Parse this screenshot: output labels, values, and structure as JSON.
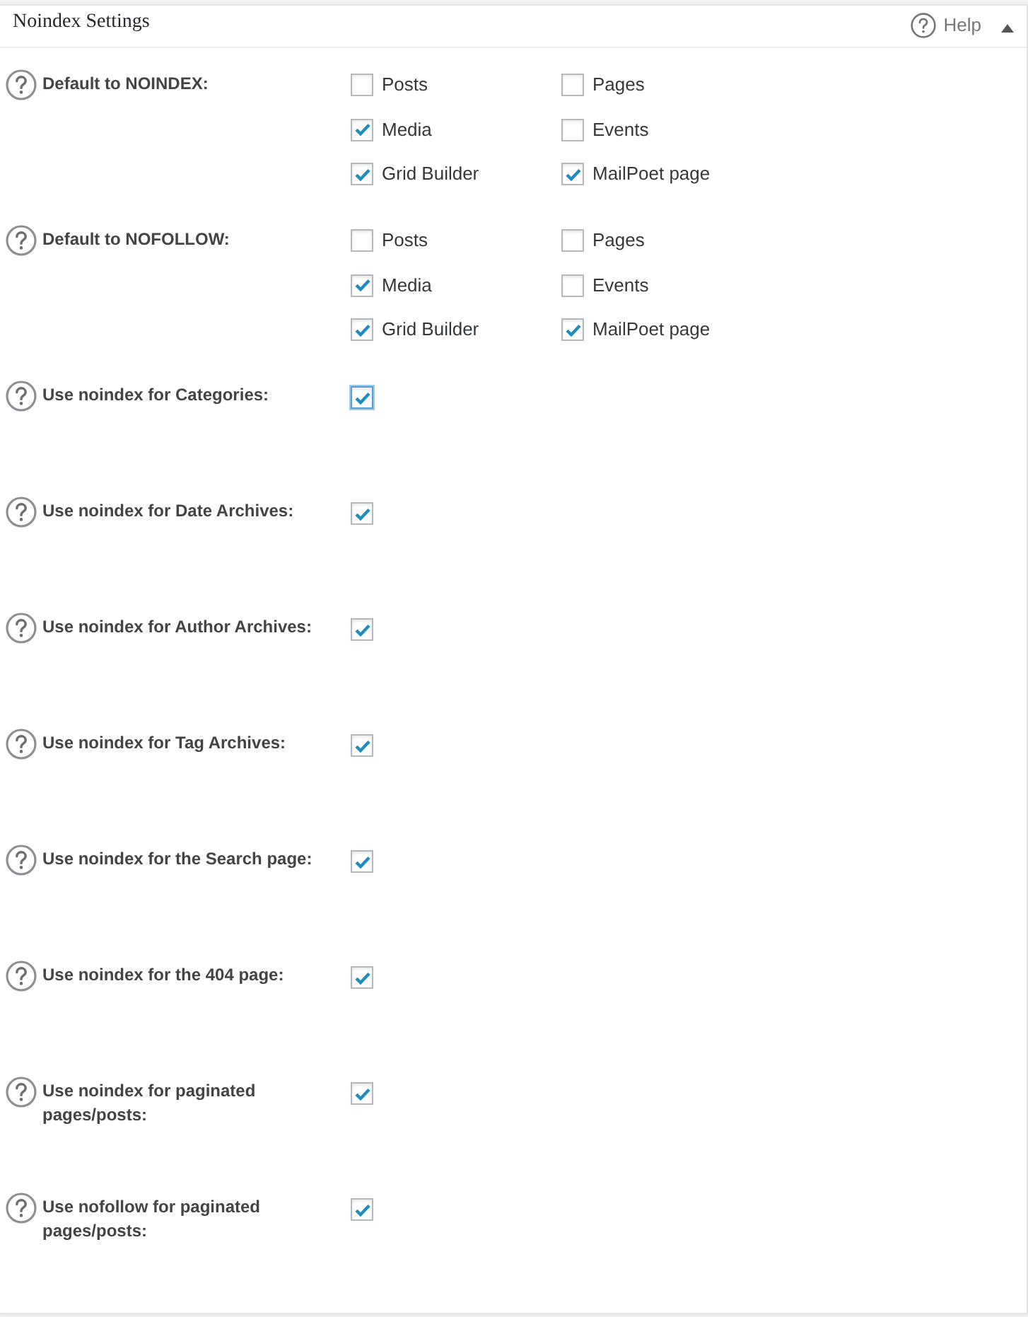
{
  "panel": {
    "title": "Noindex Settings",
    "help_label": "Help",
    "expanded": true
  },
  "settings": [
    {
      "kind": "group",
      "label": "Default to NOINDEX:",
      "options": [
        {
          "label": "Posts",
          "checked": false
        },
        {
          "label": "Pages",
          "checked": false
        },
        {
          "label": "Media",
          "checked": true
        },
        {
          "label": "Events",
          "checked": false
        },
        {
          "label": "Grid Builder",
          "checked": true
        },
        {
          "label": "MailPoet page",
          "checked": true
        }
      ]
    },
    {
      "kind": "group",
      "label": "Default to NOFOLLOW:",
      "options": [
        {
          "label": "Posts",
          "checked": false
        },
        {
          "label": "Pages",
          "checked": false
        },
        {
          "label": "Media",
          "checked": true
        },
        {
          "label": "Events",
          "checked": false
        },
        {
          "label": "Grid Builder",
          "checked": true
        },
        {
          "label": "MailPoet page",
          "checked": true
        }
      ]
    },
    {
      "kind": "single",
      "label": "Use noindex for Categories:",
      "checked": true,
      "focused": true
    },
    {
      "kind": "single",
      "label": "Use noindex for Date Archives:",
      "checked": true,
      "focused": false
    },
    {
      "kind": "single",
      "label": "Use noindex for Author Archives:",
      "checked": true,
      "focused": false
    },
    {
      "kind": "single",
      "label": "Use noindex for Tag Archives:",
      "checked": true,
      "focused": false
    },
    {
      "kind": "single",
      "label": "Use noindex for the Search page:",
      "checked": true,
      "focused": false
    },
    {
      "kind": "single",
      "label": "Use noindex for the 404 page:",
      "checked": true,
      "focused": false
    },
    {
      "kind": "single",
      "label": "Use noindex for paginated pages/posts:",
      "checked": true,
      "focused": false
    },
    {
      "kind": "single",
      "label": "Use nofollow for paginated pages/posts:",
      "checked": true,
      "focused": false
    }
  ]
}
